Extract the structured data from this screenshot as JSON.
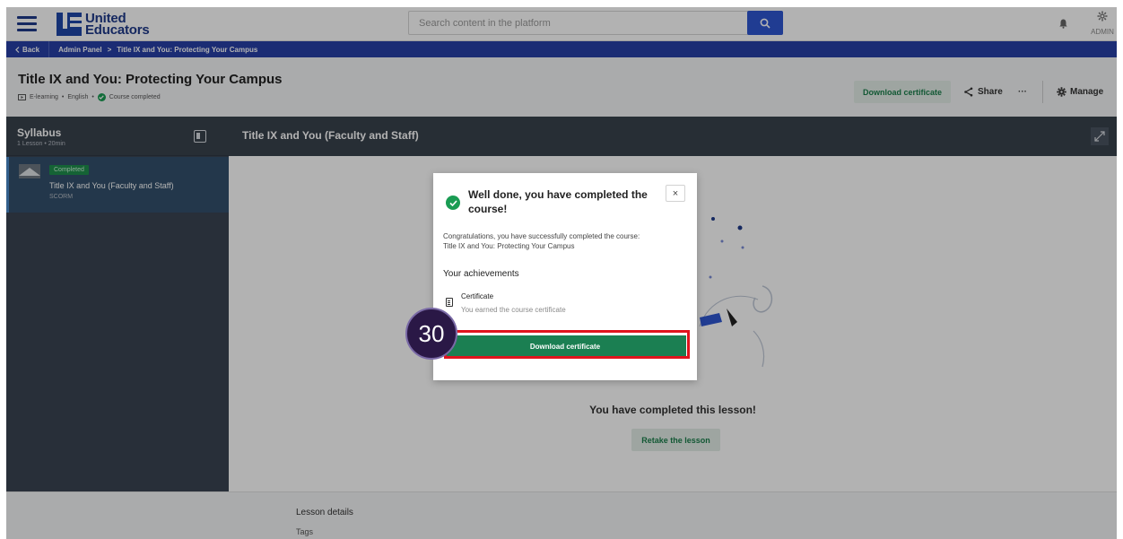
{
  "topnav": {
    "logo_line1": "United",
    "logo_line2": "Educators",
    "search_placeholder": "Search content in the platform",
    "admin_label": "ADMIN"
  },
  "breadcrumb": {
    "back": "Back",
    "items": [
      "Admin Panel",
      "Title IX and You: Protecting Your Campus"
    ],
    "separator": ">"
  },
  "page": {
    "title": "Title IX and You: Protecting Your Campus",
    "meta_format": "E-learning",
    "meta_language": "English",
    "meta_status": "Course completed",
    "download_certificate": "Download certificate",
    "share": "Share",
    "more": "···",
    "manage": "Manage"
  },
  "syllabus": {
    "title": "Syllabus",
    "subtitle": "1 Lesson • 20min",
    "lessons": [
      {
        "badge": "Completed",
        "title": "Title IX and You (Faculty and Staff)",
        "type": "SCORM"
      }
    ]
  },
  "content": {
    "title": "Title IX and You (Faculty and Staff)",
    "completed_text": "You have completed this lesson!",
    "retake": "Retake the lesson"
  },
  "details": {
    "title": "Lesson details",
    "tags": "Tags"
  },
  "modal": {
    "title": "Well done, you have completed the course!",
    "close": "×",
    "body_line1": "Congratulations, you have successfully completed the course:",
    "body_line2": "Title IX and You: Protecting Your Campus",
    "achievements_title": "Your achievements",
    "cert_title": "Certificate",
    "cert_sub": "You earned the course certificate",
    "download": "Download certificate"
  },
  "annotation": {
    "step": "30",
    "highlight_color": "#e0141e"
  },
  "colors": {
    "brand_blue": "#2740a6",
    "accent_green": "#1b7f52",
    "sidebar_dark": "#3a4452"
  }
}
